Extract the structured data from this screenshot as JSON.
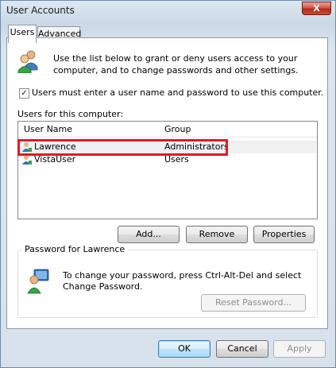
{
  "window": {
    "title": "User Accounts",
    "close_label": "X"
  },
  "tabs": [
    {
      "label": "Users"
    },
    {
      "label": "Advanced"
    }
  ],
  "users_tab": {
    "intro": "Use the list below to grant or deny users access to your computer, and to change passwords and other settings.",
    "checkbox_label": "Users must enter a user name and password to use this computer.",
    "checkbox_checked": true,
    "list_label": "Users for this computer:",
    "columns": [
      "User Name",
      "Group"
    ],
    "rows": [
      {
        "name": "Lawrence",
        "group": "Administrators",
        "selected": true
      },
      {
        "name": "VistaUser",
        "group": "Users",
        "selected": false
      }
    ],
    "buttons": {
      "add": "Add...",
      "remove": "Remove",
      "properties": "Properties"
    },
    "password_group": {
      "title": "Password for Lawrence",
      "text": "To change your password, press Ctrl-Alt-Del and select Change Password.",
      "reset_button": "Reset Password..."
    }
  },
  "footer": {
    "ok": "OK",
    "cancel": "Cancel",
    "apply": "Apply"
  },
  "icons": {
    "users": "users-icon",
    "user": "user-icon",
    "password": "password-icon"
  },
  "colors": {
    "highlight_box": "#e01b24",
    "default_button": "#3c7fb1"
  }
}
